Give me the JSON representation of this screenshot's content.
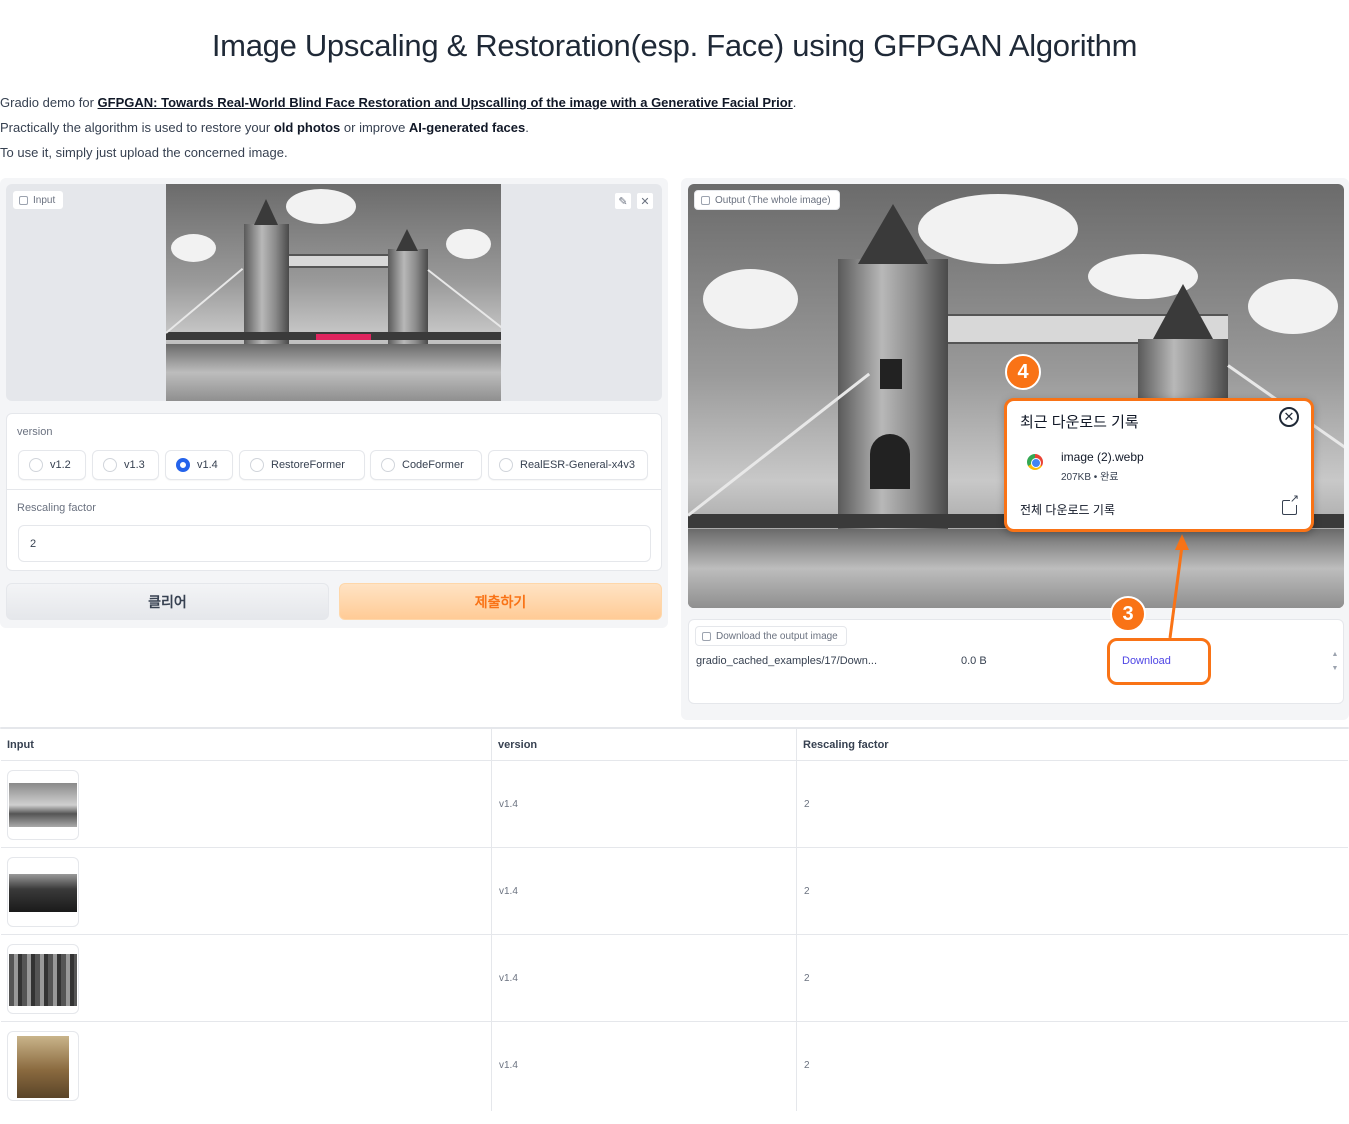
{
  "header": {
    "title": "Image Upscaling & Restoration(esp. Face) using GFPGAN Algorithm"
  },
  "description": {
    "line1_prefix": "Gradio demo for ",
    "line1_link": "GFPGAN: Towards Real-World Blind Face Restoration and Upscalling of the image with a Generative Facial Prior",
    "line1_suffix": ".",
    "line2_prefix": "Practically the algorithm is used to restore your ",
    "line2_bold1": "old photos",
    "line2_mid": " or improve ",
    "line2_bold2": "AI-generated faces",
    "line2_suffix": ".",
    "line3": "To use it, simply just upload the concerned image."
  },
  "input_panel": {
    "image_label": "Input",
    "edit_icon": "pencil-icon",
    "close_icon": "close-icon",
    "version_label": "version",
    "versions": [
      "v1.2",
      "v1.3",
      "v1.4",
      "RestoreFormer",
      "CodeFormer",
      "RealESR-General-x4v3"
    ],
    "selected_version": "v1.4",
    "rescale_label": "Rescaling factor",
    "rescale_value": "2",
    "clear_button": "클리어",
    "submit_button": "제출하기"
  },
  "output_panel": {
    "image_label": "Output (The whole image)",
    "file_label": "Download the output image",
    "file_name": "gradio_cached_examples/17/Down...",
    "file_size": "0.0 B",
    "download_link": "Download"
  },
  "download_popup": {
    "title": "최근 다운로드 기록",
    "file_name": "image (2).webp",
    "file_meta": "207KB • 완료",
    "all_history": "전체 다운로드 기록"
  },
  "annotations": {
    "badge_3": "3",
    "badge_4": "4"
  },
  "examples": {
    "headers": [
      "Input",
      "version",
      "Rescaling factor"
    ],
    "rows": [
      {
        "version": "v1.4",
        "rescale": "2"
      },
      {
        "version": "v1.4",
        "rescale": "2"
      },
      {
        "version": "v1.4",
        "rescale": "2"
      },
      {
        "version": "v1.4",
        "rescale": "2"
      }
    ]
  },
  "colors": {
    "accent": "#f97316",
    "radio_selected": "#2563eb",
    "link": "#4f46e5"
  }
}
